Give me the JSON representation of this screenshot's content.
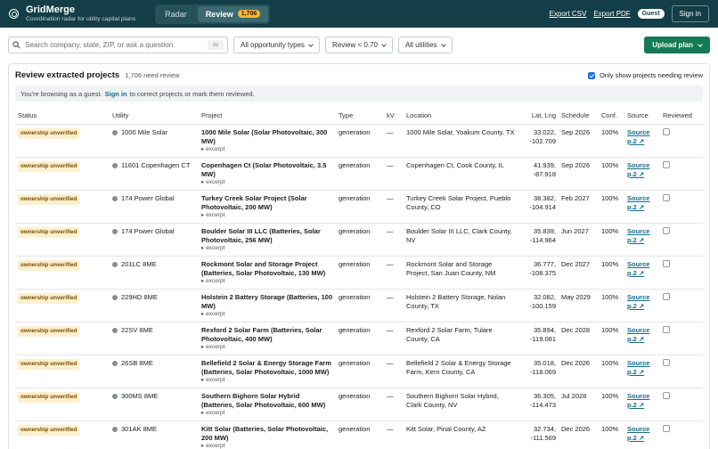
{
  "header": {
    "app_name": "GridMerge",
    "tagline": "Coordination radar for utility capital plans",
    "tabs": [
      {
        "label": "Radar"
      },
      {
        "label": "Review",
        "badge": "1,706"
      }
    ],
    "export_csv": "Export CSV",
    "export_pdf": "Export PDF",
    "guest_badge": "Guest",
    "sign_in": "Sign in"
  },
  "toolbar": {
    "search_placeholder": "Search company, state, ZIP, or ask a question",
    "ai_label": "AI",
    "filter_opportunity": "All opportunity types",
    "filter_review": "Review < 0.70",
    "filter_utilities": "All utilities",
    "upload_label": "Upload plan"
  },
  "panel": {
    "title": "Review extracted projects",
    "count_text": "1,706 need review",
    "checkbox_label": "Only show projects needing review",
    "notice_pre": "You're browsing as a guest.",
    "notice_link": "Sign in",
    "notice_post": "to correct projects or mark them reviewed."
  },
  "table": {
    "columns": [
      "Status",
      "Utility",
      "Project",
      "Type",
      "kV",
      "Location",
      "Lat, Lng",
      "Schedule",
      "Conf.",
      "Source",
      "Reviewed"
    ],
    "rows": [
      {
        "status": "ownership unverified",
        "utility": "1000 Mile Solar",
        "project": "1000 Mile Solar (Solar Photovoltaic, 300 MW)",
        "excerpt": "▸ excerpt",
        "type": "generation",
        "kv": "—",
        "location": "1000 Mile Solar, Yoakum County, TX",
        "lat": "33.022,",
        "lng": "-102.709",
        "schedule": "Sep 2026",
        "conf": "100%",
        "source": "Source",
        "page": "p.2 ↗"
      },
      {
        "status": "ownership unverified",
        "utility": "11601 Copenhagen CT",
        "project": "Copenhagen Ct (Solar Photovoltaic, 3.5 MW)",
        "excerpt": "▸ excerpt",
        "type": "generation",
        "kv": "—",
        "location": "Copenhagen Ct, Cook County, IL",
        "lat": "41.939,",
        "lng": "-87.918",
        "schedule": "Sep 2026",
        "conf": "100%",
        "source": "Source",
        "page": "p.2 ↗"
      },
      {
        "status": "ownership unverified",
        "utility": "174 Power Global",
        "project": "Turkey Creek Solar Project (Solar Photovoltaic, 200 MW)",
        "excerpt": "▸ excerpt",
        "type": "generation",
        "kv": "—",
        "location": "Turkey Creek Solar Project, Pueblo County, CO",
        "lat": "38.382,",
        "lng": "-104.914",
        "schedule": "Feb 2027",
        "conf": "100%",
        "source": "Source",
        "page": "p.2 ↗"
      },
      {
        "status": "ownership unverified",
        "utility": "174 Power Global",
        "project": "Boulder Solar III LLC (Batteries, Solar Photovoltaic, 256 MW)",
        "excerpt": "▸ excerpt",
        "type": "generation",
        "kv": "—",
        "location": "Boulder Solar III LLC, Clark County, NV",
        "lat": "35.839,",
        "lng": "-114.964",
        "schedule": "Jun 2027",
        "conf": "100%",
        "source": "Source",
        "page": "p.2 ↗"
      },
      {
        "status": "ownership unverified",
        "utility": "201LC 8ME",
        "project": "Rockmont Solar and Storage Project (Batteries, Solar Photovoltaic, 130 MW)",
        "excerpt": "▸ excerpt",
        "type": "generation",
        "kv": "—",
        "location": "Rockmont Solar and Storage Project, San Juan County, NM",
        "lat": "36.777,",
        "lng": "-108.375",
        "schedule": "Dec 2027",
        "conf": "100%",
        "source": "Source",
        "page": "p.2 ↗"
      },
      {
        "status": "ownership unverified",
        "utility": "229HD 8ME",
        "project": "Holstein 2 Battery Storage (Batteries, 100 MW)",
        "excerpt": "▸ excerpt",
        "type": "generation",
        "kv": "—",
        "location": "Holstein 2 Battery Storage, Nolan County, TX",
        "lat": "32.082,",
        "lng": "-100.159",
        "schedule": "May 2029",
        "conf": "100%",
        "source": "Source",
        "page": "p.2 ↗"
      },
      {
        "status": "ownership unverified",
        "utility": "22SV 8ME",
        "project": "Rexford 2 Solar Farm (Batteries, Solar Photovoltaic, 400 MW)",
        "excerpt": "▸ excerpt",
        "type": "generation",
        "kv": "—",
        "location": "Rexford 2 Solar Farm, Tulare County, CA",
        "lat": "35.894,",
        "lng": "-119.081",
        "schedule": "Dec 2028",
        "conf": "100%",
        "source": "Source",
        "page": "p.2 ↗"
      },
      {
        "status": "ownership unverified",
        "utility": "26SB 8ME",
        "project": "Bellefield 2 Solar & Energy Storage Farm (Batteries, Solar Photovoltaic, 1000 MW)",
        "excerpt": "▸ excerpt",
        "type": "generation",
        "kv": "—",
        "location": "Bellefield 2 Solar & Energy Storage Farm, Kern County, CA",
        "lat": "35.018,",
        "lng": "-118.069",
        "schedule": "Dec 2026",
        "conf": "100%",
        "source": "Source",
        "page": "p.2 ↗"
      },
      {
        "status": "ownership unverified",
        "utility": "300MS 8ME",
        "project": "Southern Bighorn Solar Hybrid (Batteries, Solar Photovoltaic, 600 MW)",
        "excerpt": "▸ excerpt",
        "type": "generation",
        "kv": "—",
        "location": "Southern Bighorn Solar Hybrid, Clark County, NV",
        "lat": "36.305,",
        "lng": "-114.473",
        "schedule": "Jul 2028",
        "conf": "100%",
        "source": "Source",
        "page": "p.2 ↗"
      },
      {
        "status": "ownership unverified",
        "utility": "301AK 8ME",
        "project": "Kitt Solar (Batteries, Solar Photovoltaic, 200 MW)",
        "excerpt": "▸ excerpt",
        "type": "generation",
        "kv": "—",
        "location": "Kitt Solar, Pinal County, AZ",
        "lat": "32.734,",
        "lng": "-111.569",
        "schedule": "Dec 2026",
        "conf": "100%",
        "source": "Source",
        "page": "p.2 ↗"
      }
    ]
  }
}
